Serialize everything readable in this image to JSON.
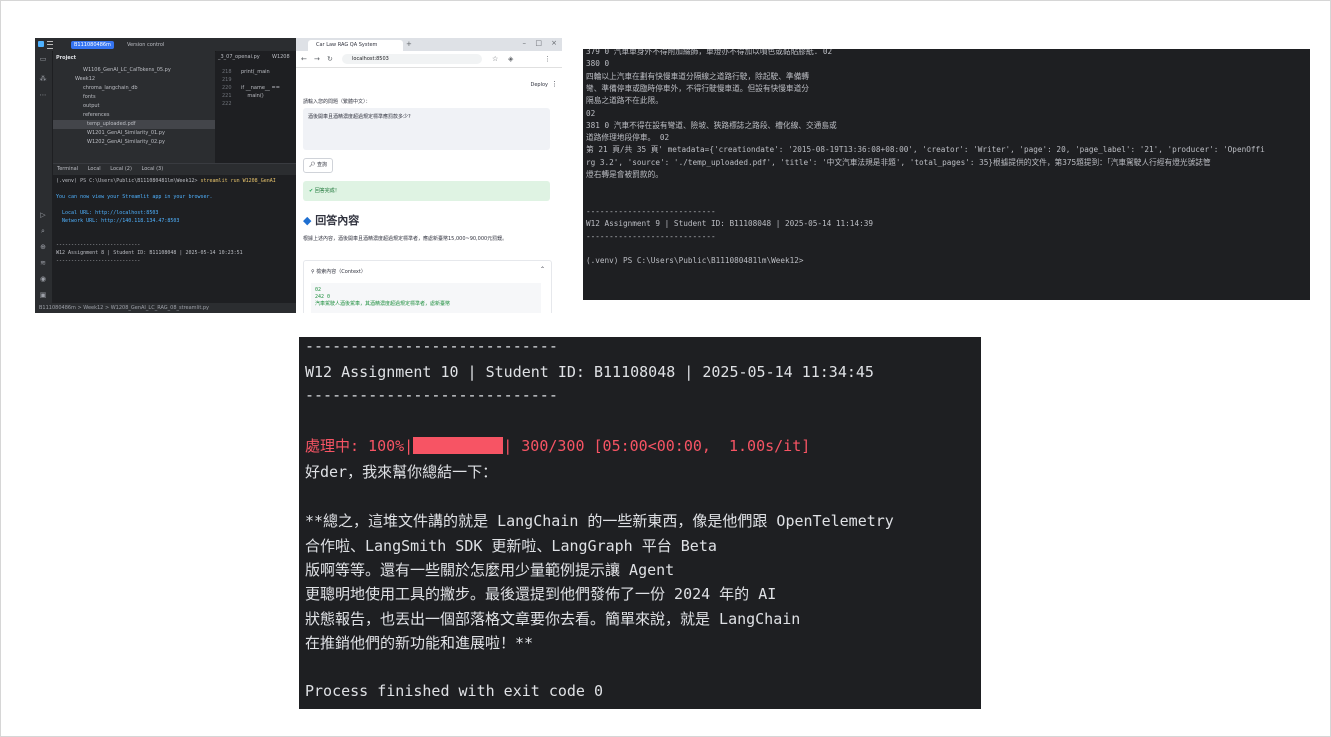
{
  "ide": {
    "project_name": "B111080486m",
    "version_control": "Version control",
    "project_header": "Project",
    "tree": [
      "W1106_GenAI_LC_CalTokens_05.py",
      "Week12",
      "chroma_langchain_db",
      "fonts",
      "output",
      "references",
      "temp_uploaded.pdf",
      "W1201_GenAI_Similarity_01.py",
      "W1202_GenAI_Similarity_02.py"
    ],
    "editor_tabs": [
      "_3_07_openai.py",
      "W1208"
    ],
    "line_numbers": "218\n219\n220\n221\n222",
    "code": "print(_main\n\nif __name__ == \n    main()\n",
    "terminal_tabs": [
      "Terminal",
      "Local",
      "Local (2)",
      "Local (3)"
    ],
    "terminal_prompt": "(.venv) PS C:\\Users\\Public\\B111080481lm\\Week12> ",
    "terminal_command": "streamlit run W1208_GenAI",
    "terminal_msg": "You can now view your Streamlit app in your browser.",
    "local_url": "  Local URL: http://localhost:8503",
    "network_url": "  Network URL: http://140.118.134.47:8503",
    "sep": "----------------------------",
    "assignment_line": "W12 Assignment 8 | Student ID: B11108048 | 2025-05-14 10:23:51",
    "status_bar": "B111080486m  >  Week12  >  W1208_GenAI_LC_RAG_08_streamlit.py"
  },
  "browser": {
    "tab_title": "Car Law RAG QA System",
    "url": "localhost:8503",
    "deploy": "Deploy",
    "input_label": "請輸入您的問題（繁體中文）：",
    "input_value": "酒後開車且酒精濃度超過規定標準應罰款多少?",
    "query_button": "查詢",
    "success_text": "回答完成！",
    "answer_heading": "回答內容",
    "answer_text": "根據上述內容，酒後開車且酒精濃度超過規定標準者，應處新臺幣15,000~90,000元罰鍰。",
    "expander_label": "檢索內容（Context）",
    "context_snippet": "02\n242 0\n汽車駕駛人酒後駕車，其酒精濃度超過規定標準者，處新臺幣"
  },
  "console2": {
    "lines": [
      "379 0 汽車車身外不得附加綴飾，車燈亦不得加以噴色或黏貼膠紙. 02",
      "380 0",
      "四輪以上汽車在劃有快慢車道分隔線之道路行駛，除起駛、準備轉",
      "彎、準備停車或臨時停車外，不得行駛慢車道。但設有快慢車道分",
      "隔島之道路不在此限。",
      "02",
      "381 0 汽車不得在設有彎道、險坡、狹路標誌之路段、槽化線、交通島或",
      "道路修理地段停車。 02",
      "第 21 頁/共 35 頁' metadata={'creationdate': '2015-08-19T13:36:08+08:00', 'creator': 'Writer', 'page': 20, 'page_label': '21', 'producer': 'OpenOffi",
      "rg 3.2', 'source': './temp_uploaded.pdf', 'title': '中文汽車法規是非題', 'total_pages': 35}根據提供的文件，第375題提到：「汽車駕駛人行經有燈光號誌管",
      "燈右轉是會被罰款的。",
      "",
      "",
      "----------------------------",
      "W12 Assignment 9 | Student ID: B11108048 | 2025-05-14 11:14:39",
      "----------------------------",
      "",
      "(.venv) PS C:\\Users\\Public\\B111080481lm\\Week12>"
    ]
  },
  "console3": {
    "sep": "----------------------------",
    "assignment_line": "W12 Assignment 10 | Student ID: B11108048 | 2025-05-14 11:34:45",
    "progress_label": "處理中: 100%|",
    "progress_value": 1.0,
    "progress_stats": "| 300/300 [05:00<00:00,  1.00s/it]",
    "summary_lines": [
      "好der，我來幫你總結一下：",
      "",
      "**總之，這堆文件講的就是 LangChain 的一些新東西，像是他們跟 OpenTelemetry",
      "合作啦、LangSmith SDK 更新啦、LangGraph 平台 Beta",
      "版啊等等。還有一些關於怎麼用少量範例提示讓 Agent",
      "更聰明地使用工具的撇步。最後還提到他們發佈了一份 2024 年的 AI",
      "狀態報告，也丟出一個部落格文章要你去看。簡單來說，就是 LangChain",
      "在推銷他們的新功能和進展啦！**"
    ],
    "exit_line": "Process finished with exit code 0"
  },
  "colors": {
    "ide_bg": "#1e1f22",
    "accent": "#3574f0",
    "progress_red": "#f75464",
    "success_green": "#dff3e3"
  }
}
